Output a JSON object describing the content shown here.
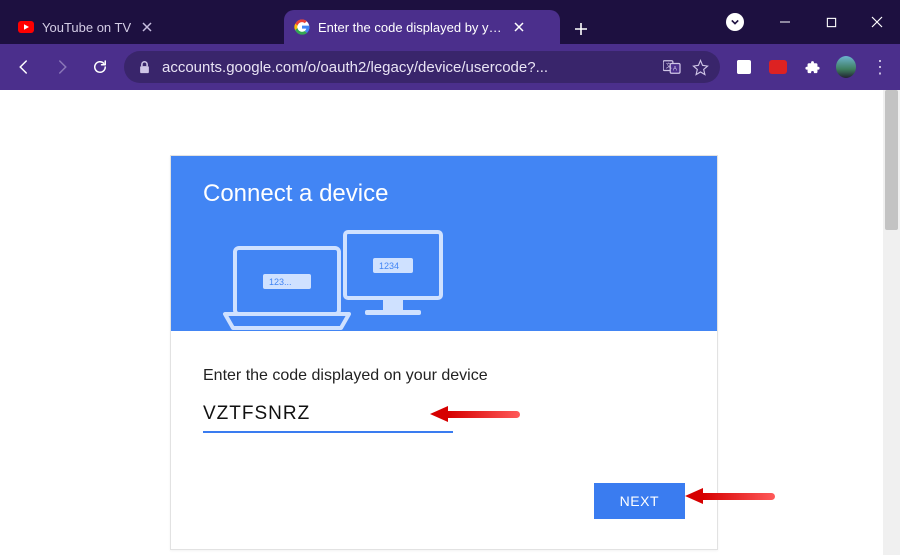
{
  "browser": {
    "tabs": [
      {
        "title": "YouTube on TV",
        "active": false
      },
      {
        "title": "Enter the code displayed by your",
        "active": true
      }
    ],
    "url": "accounts.google.com/o/oauth2/legacy/device/usercode?..."
  },
  "page": {
    "banner_title": "Connect a device",
    "illus_codes": {
      "laptop": "123...",
      "monitor": "1234"
    },
    "prompt": "Enter the code displayed on your device",
    "code_value": "VZTFSNRZ",
    "next_label": "NEXT"
  }
}
